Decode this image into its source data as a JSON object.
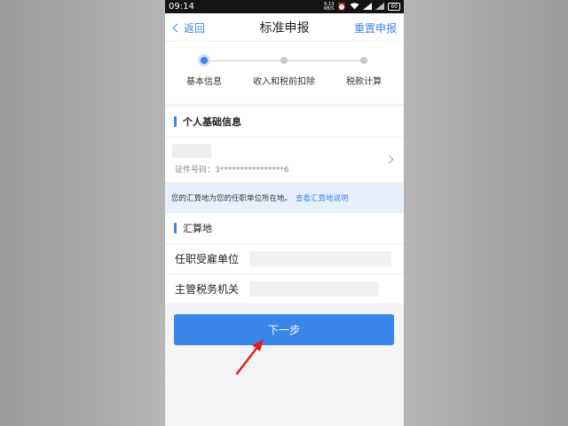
{
  "status_bar": {
    "time": "09:14",
    "net_speed_top": "6.13",
    "net_speed_bottom": "KB/S",
    "battery": "60"
  },
  "nav": {
    "back_label": "返回",
    "title": "标准申报",
    "reset_label": "重置申报"
  },
  "stepper": {
    "steps": [
      {
        "label": "基本信息",
        "active": true
      },
      {
        "label": "收入和税前扣除",
        "active": false
      },
      {
        "label": "税款计算",
        "active": false
      }
    ]
  },
  "personal_section": {
    "title": "个人基础信息",
    "id_label": "证件号码：",
    "id_value": "3****************6"
  },
  "notice": {
    "text": "您的汇算地为您的任职单位所在地。",
    "link": "查看汇算地说明"
  },
  "settlement_section": {
    "title": "汇算地",
    "fields": [
      {
        "label": "任职受雇单位"
      },
      {
        "label": "主管税务机关"
      }
    ]
  },
  "next_button_label": "下一步",
  "colors": {
    "accent": "#3a86e8",
    "annotation_arrow": "#e02020"
  }
}
